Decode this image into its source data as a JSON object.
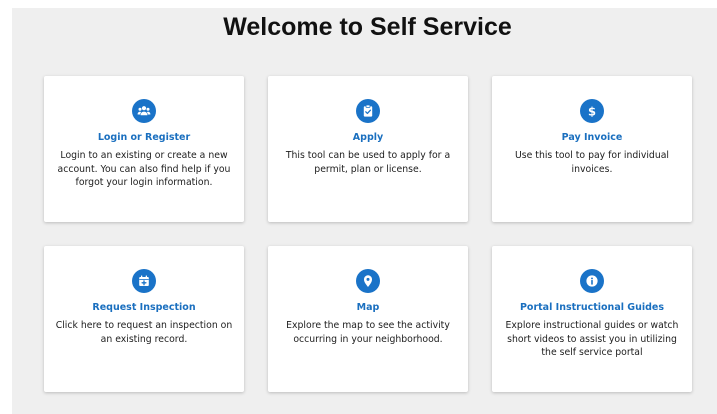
{
  "page": {
    "title": "Welcome to Self Service"
  },
  "theme": {
    "accent": "#1a73c8",
    "link": "#1a6fbf",
    "panel_bg": "#efefef",
    "card_bg": "#ffffff"
  },
  "cards": [
    {
      "icon": "users-icon",
      "title": "Login or Register",
      "description": "Login to an existing or create a new account. You can also find help if you forgot your login information."
    },
    {
      "icon": "clipboard-check-icon",
      "title": "Apply",
      "description": "This tool can be used to apply for a permit, plan or license."
    },
    {
      "icon": "dollar-icon",
      "title": "Pay Invoice",
      "description": "Use this tool to pay for individual invoices."
    },
    {
      "icon": "calendar-plus-icon",
      "title": "Request Inspection",
      "description": "Click here to request an inspection on an existing record."
    },
    {
      "icon": "map-pin-icon",
      "title": "Map",
      "description": "Explore the map to see the activity occurring in your neighborhood."
    },
    {
      "icon": "info-icon",
      "title": "Portal Instructional Guides",
      "description": "Explore instructional guides or watch short videos to assist you in utilizing the self service portal"
    }
  ]
}
